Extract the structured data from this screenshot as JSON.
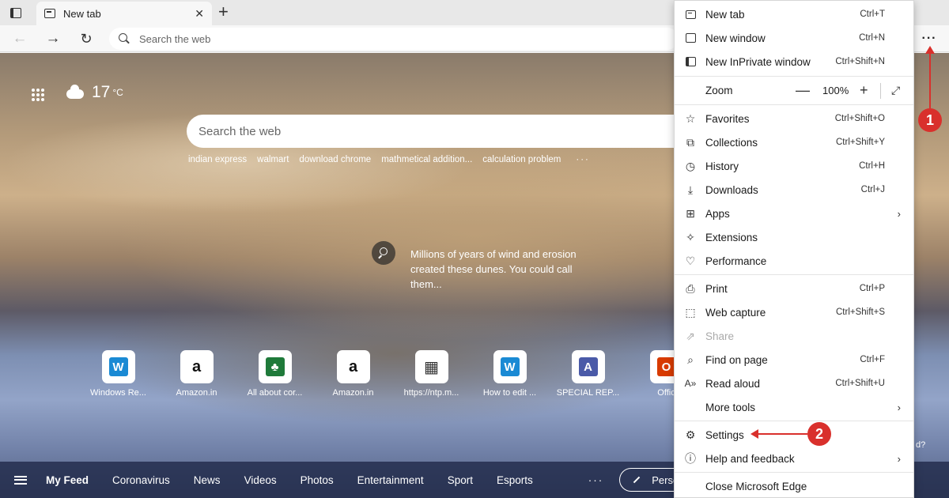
{
  "tab": {
    "title": "New tab",
    "close": "✕",
    "new_tab": "+"
  },
  "toolbar": {
    "back": "←",
    "forward": "→",
    "refresh": "↻",
    "address_placeholder": "Search the web",
    "more": "···"
  },
  "ntp": {
    "weather": {
      "temp": "17",
      "unit": "°C"
    },
    "search_placeholder": "Search the web",
    "suggestions": [
      "indian express",
      "walmart",
      "download chrome",
      "mathmetical addition...",
      "calculation problem"
    ],
    "suggestions_more": "···",
    "caption": "Millions of years of wind and erosion created these dunes. You could call them...",
    "quick_links": [
      {
        "label": "Windows Re...",
        "glyph": "W",
        "color": "#1a8ad4"
      },
      {
        "label": "Amazon.in",
        "glyph": "a",
        "color": "#111111"
      },
      {
        "label": "All about cor...",
        "glyph": "♣",
        "color": "#1f7a3a"
      },
      {
        "label": "Amazon.in",
        "glyph": "a",
        "color": "#111111"
      },
      {
        "label": "https://ntp.m...",
        "glyph": "▦",
        "color": "#333333"
      },
      {
        "label": "How to edit ...",
        "glyph": "W",
        "color": "#1a8ad4"
      },
      {
        "label": "SPECIAL REP...",
        "glyph": "A",
        "color": "#4a5aa8"
      },
      {
        "label": "Offic",
        "glyph": "O",
        "color": "#d83b01"
      }
    ],
    "feed": {
      "items": [
        "My Feed",
        "Coronavirus",
        "News",
        "Videos",
        "Photos",
        "Entertainment",
        "Sport",
        "Esports"
      ],
      "more": "···",
      "personalise": "Personalis"
    },
    "tail_text": "d?"
  },
  "menu": {
    "new_tab": {
      "label": "New tab",
      "shortcut": "Ctrl+T"
    },
    "new_window": {
      "label": "New window",
      "shortcut": "Ctrl+N"
    },
    "new_inprivate": {
      "label": "New InPrivate window",
      "shortcut": "Ctrl+Shift+N"
    },
    "zoom": {
      "label": "Zoom",
      "minus": "—",
      "value": "100%",
      "plus": "+",
      "fullscreen": "⤢"
    },
    "favorites": {
      "label": "Favorites",
      "shortcut": "Ctrl+Shift+O"
    },
    "collections": {
      "label": "Collections",
      "shortcut": "Ctrl+Shift+Y"
    },
    "history": {
      "label": "History",
      "shortcut": "Ctrl+H"
    },
    "downloads": {
      "label": "Downloads",
      "shortcut": "Ctrl+J"
    },
    "apps": {
      "label": "Apps",
      "arrow": "›"
    },
    "extensions": {
      "label": "Extensions"
    },
    "performance": {
      "label": "Performance"
    },
    "print": {
      "label": "Print",
      "shortcut": "Ctrl+P"
    },
    "web_capture": {
      "label": "Web capture",
      "shortcut": "Ctrl+Shift+S"
    },
    "share": {
      "label": "Share"
    },
    "find_on_page": {
      "label": "Find on page",
      "shortcut": "Ctrl+F"
    },
    "read_aloud": {
      "label": "Read aloud",
      "shortcut": "Ctrl+Shift+U"
    },
    "more_tools": {
      "label": "More tools",
      "arrow": "›"
    },
    "settings": {
      "label": "Settings"
    },
    "help": {
      "label": "Help and feedback",
      "arrow": "›"
    },
    "close": {
      "label": "Close Microsoft Edge"
    }
  },
  "annotations": {
    "step1": "1",
    "step2": "2",
    "color": "#d9302c"
  }
}
